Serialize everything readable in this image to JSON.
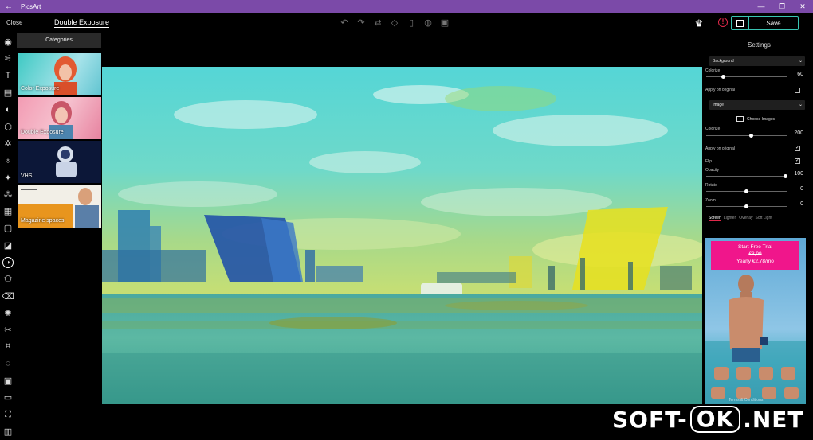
{
  "app": {
    "title": "PicsArt"
  },
  "topbar": {
    "close_label": "Close",
    "tool_title": "Double Exposure",
    "save_label": "Save"
  },
  "categories": {
    "button_label": "Categories",
    "items": [
      {
        "label": "Color Exposure"
      },
      {
        "label": "Double Exposure"
      },
      {
        "label": "VHS"
      },
      {
        "label": "Magazine spaces"
      }
    ]
  },
  "left_tools": [
    "adjust-icon",
    "text-icon",
    "sticker-icon",
    "mask-icon",
    "shape-icon",
    "magic-icon",
    "brush-icon",
    "sparkle-icon",
    "effects-icon",
    "texture-icon",
    "frame-icon",
    "border-icon",
    "double-exposure-icon",
    "eraser-icon",
    "clone-icon",
    "lens-flare-icon",
    "cutout-icon",
    "crop-icon",
    "circle-select-icon",
    "square-fit-icon",
    "picture-icon",
    "gallery-icon",
    "collage-icon"
  ],
  "settings": {
    "header": "Settings",
    "background_dropdown": "Background",
    "colorize1_label": "Colorize",
    "colorize1_value": "60",
    "colorize1_fraction": 0.21,
    "apply_original1_label": "Apply on original",
    "apply_original1_checked": false,
    "image_dropdown": "Image",
    "choose_images": "Choose Images",
    "colorize2_label": "Colorize",
    "colorize2_value": "200",
    "colorize2_fraction": 0.55,
    "apply_original2_label": "Apply on original",
    "apply_original2_checked": true,
    "flip_label": "Flip",
    "flip_checked": true,
    "opacity_label": "Opacity",
    "opacity_value": "100",
    "opacity_fraction": 1.0,
    "rotate_label": "Rotate",
    "rotate_value": "0",
    "rotate_fraction": 0.5,
    "zoom_label": "Zoom",
    "zoom_value": "0",
    "zoom_fraction": 0.5,
    "blend_modes": [
      "Screen",
      "Lighten",
      "Overlay",
      "Soft Light"
    ],
    "active_blend_mode": "Screen"
  },
  "ad": {
    "line1": "Start Free Trial",
    "line2": "€3,99",
    "line3": "Yearly €2,78/mo",
    "terms": "Terms & Conditions"
  },
  "watermark": {
    "left": "SOFT-",
    "mid": "OK",
    "right": ".NET"
  },
  "colors": {
    "titlebar": "#7b4aa8",
    "accent": "#39c4b2",
    "alert": "#e0284a",
    "ad_banner": "#f0168b"
  }
}
